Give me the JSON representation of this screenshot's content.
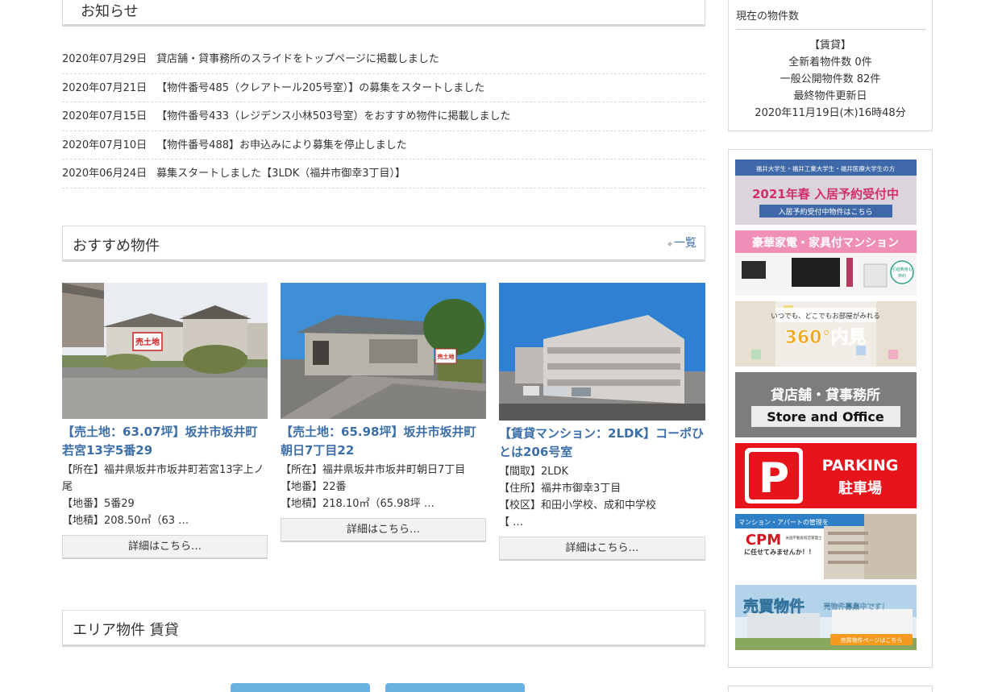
{
  "news": {
    "title": "お知らせ",
    "items": [
      {
        "date": "2020年07月29日",
        "text": "貸店舗・貸事務所のスライドをトップページに掲載しました"
      },
      {
        "date": "2020年07月21日",
        "text": "【物件番号485（クレアトール205号室）】の募集をスタートしました"
      },
      {
        "date": "2020年07月15日",
        "text": "【物件番号433（レジデンス小林503号室）をおすすめ物件に掲載しました"
      },
      {
        "date": "2020年07月10日",
        "text": "【物件番号488】お申込みにより募集を停止しました"
      },
      {
        "date": "2020年06月24日",
        "text": "募集スタートしました【3LDK（福井市御幸3丁目）】"
      }
    ]
  },
  "recommend": {
    "title": "おすすめ物件",
    "all_link": "一覧",
    "cards": [
      {
        "title": "【売土地：63.07坪】坂井市坂井町若宮13字5番29",
        "info": [
          "【所在】福井県坂井市坂井町若宮13字上ノ尾",
          "【地番】5番29",
          "【地積】208.50㎡（63 …"
        ],
        "button": "詳細はこちら…",
        "sign": "売土地"
      },
      {
        "title": "【売土地：65.98坪】坂井市坂井町朝日7丁目22",
        "info": [
          "【所在】福井県坂井市坂井町朝日7丁目",
          "【地番】22番",
          "【地積】218.10㎡（65.98坪 …"
        ],
        "button": "詳細はこちら…",
        "sign": "売土地"
      },
      {
        "title": "【賃貸マンション：2LDK】コーポひとは206号室",
        "info": [
          "【間取】2LDK",
          "【住所】福井市御幸3丁目",
          "【校区】和田小学校、成和中学校",
          "【 …"
        ],
        "button": "詳細はこちら…"
      }
    ]
  },
  "area": {
    "title": "エリア物件 賃貸"
  },
  "sidebar": {
    "count": {
      "heading": "現在の物件数",
      "lines": [
        "【賃貸】",
        "全新着物件数 0件",
        "一般公開物件数 82件",
        "最終物件更新日",
        "2020年11月19日(木)16時48分"
      ]
    },
    "banners": [
      {
        "line1": "福井大学生・福井工業大学生・福井医療大学生の方",
        "line2": "2021年春 入居予約受付中",
        "line3": "入居予約受付中物件はこちら"
      },
      {
        "line1": "豪華家電・家具付マンション",
        "line2": "引越費用も",
        "line3": "節約"
      },
      {
        "line1": "いつでも、どこでもお部屋がみれる",
        "line2": "360°内見"
      },
      {
        "line1": "貸店舗・貸事務所",
        "line2": "Store and Office"
      },
      {
        "line1": "P",
        "line2": "PARKING",
        "line3": "駐車場"
      },
      {
        "line1": "マンション・アパートの管理を",
        "line2": "CPM",
        "line3": "に任せてみませんか！！",
        "line4": "米国不動産経営管理士"
      },
      {
        "line1": "売買物件",
        "line2": "売物件募集中です！",
        "line3": "売買物件ページはこちら"
      }
    ]
  },
  "colors": {
    "link": "#3c6ea8",
    "parking_red": "#e8141b",
    "area_button": "#6ab0e0"
  }
}
